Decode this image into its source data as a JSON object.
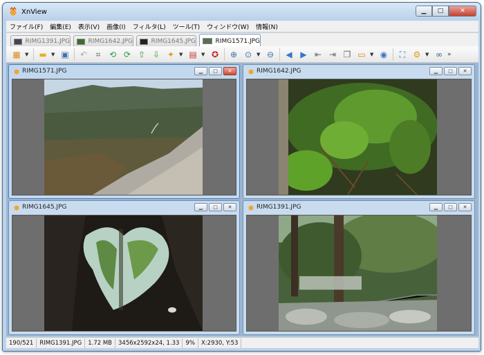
{
  "window": {
    "title": "XnView"
  },
  "caption_buttons": {
    "minimize": "▁",
    "maximize": "□",
    "close": "✕"
  },
  "menu": [
    "ファイル(F)",
    "編集(E)",
    "表示(V)",
    "画像(I)",
    "フィルタ(L)",
    "ツール(T)",
    "ウィンドウ(W)",
    "情報(N)"
  ],
  "tabs": [
    {
      "label": "RIMG1391.JPG",
      "active": false
    },
    {
      "label": "RIMG1642.JPG",
      "active": false
    },
    {
      "label": "RIMG1645.JPG",
      "active": false
    },
    {
      "label": "RIMG1571.JPG",
      "active": true
    }
  ],
  "toolbar": {
    "icons": [
      "browser-icon",
      "open-folder-icon",
      "save-icon",
      "undo-icon",
      "crop-icon",
      "rotate-left-icon",
      "rotate-right-icon",
      "export-icon",
      "import-icon",
      "convert-icon",
      "color-icon",
      "award-icon",
      "zoom-in-icon",
      "zoom-icon",
      "zoom-out-icon",
      "prev-icon",
      "next-icon",
      "first-icon",
      "last-icon",
      "copy-icon",
      "slideshow-icon",
      "capture-icon",
      "fullscreen-icon",
      "settings-icon",
      "binoculars-icon"
    ],
    "overflow": "»"
  },
  "children": [
    {
      "title": "RIMG1571.JPG",
      "active": true
    },
    {
      "title": "RIMG1642.JPG",
      "active": false
    },
    {
      "title": "RIMG1645.JPG",
      "active": false
    },
    {
      "title": "RIMG1391.JPG",
      "active": false
    }
  ],
  "status": {
    "count": "190/521",
    "filename": "RIMG1391.JPG",
    "size": "1.72 MB",
    "dimensions": "3456x2592x24, 1.33",
    "zoom": "9%",
    "coords": "X:2930, Y:53"
  },
  "colors": {
    "window_frame": "#bcd3ea",
    "mdi_background": "#9cb6d2",
    "viewport_gray": "#6e6e6e",
    "close_red": "#c4412f"
  }
}
